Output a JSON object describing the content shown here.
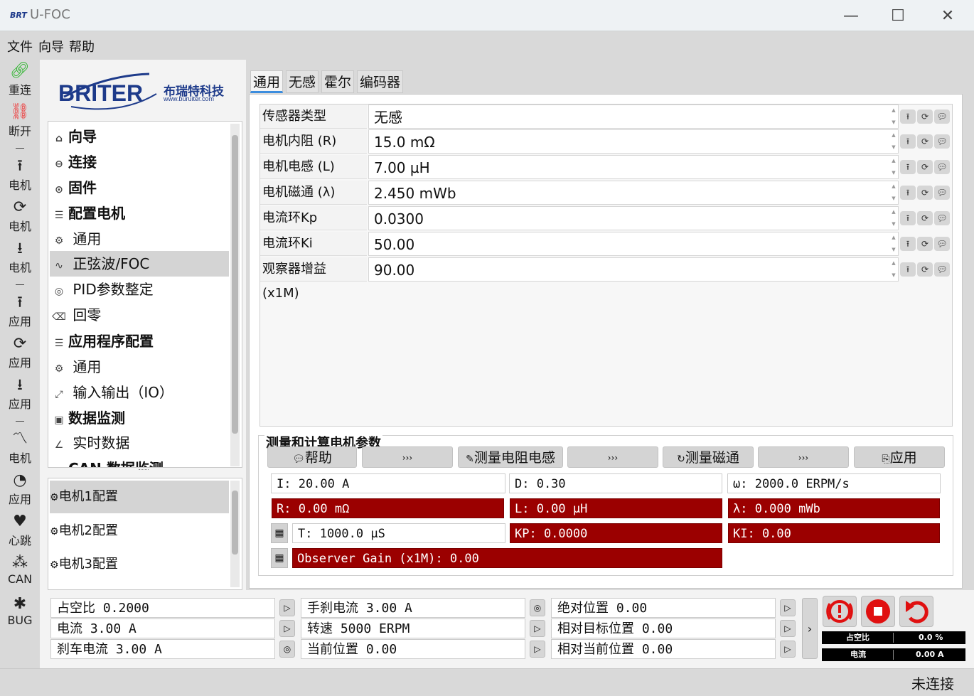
{
  "window": {
    "logo": "BRT",
    "title": "U-FOC",
    "min": "—",
    "max": "☐",
    "close": "✕"
  },
  "menu": [
    "文件",
    "向导",
    "帮助"
  ],
  "leftbar": [
    {
      "label": "重连",
      "icon": "link-icon"
    },
    {
      "label": "断开",
      "icon": "unlink-icon"
    },
    {
      "label": "电机",
      "icon": "upload-icon"
    },
    {
      "label": "电机",
      "icon": "refresh-icon"
    },
    {
      "label": "电机",
      "icon": "download-icon"
    },
    {
      "label": "应用",
      "icon": "upload-icon"
    },
    {
      "label": "应用",
      "icon": "refresh-icon"
    },
    {
      "label": "应用",
      "icon": "download-icon"
    },
    {
      "label": "电机",
      "icon": "chart-icon"
    },
    {
      "label": "应用",
      "icon": "gauge-icon"
    },
    {
      "label": "心跳",
      "icon": "heartbeat-icon"
    },
    {
      "label": "CAN",
      "icon": "can-icon"
    },
    {
      "label": "BUG",
      "icon": "bug-icon"
    }
  ],
  "brand": {
    "name": "BRITER",
    "chinese": "布瑞特科技",
    "url": "www.buruiter.com"
  },
  "nav": [
    {
      "label": "向导",
      "icon": "⌂",
      "bold": true
    },
    {
      "label": "连接",
      "icon": "⊖",
      "bold": true
    },
    {
      "label": "固件",
      "icon": "⊙",
      "bold": true
    },
    {
      "label": "配置电机",
      "icon": "☰",
      "bold": true
    },
    {
      "label": "通用",
      "icon": "⚙",
      "bold": false
    },
    {
      "label": "正弦波/FOC",
      "icon": "∿",
      "bold": false
    },
    {
      "label": "PID参数整定",
      "icon": "◎",
      "bold": false
    },
    {
      "label": "回零",
      "icon": "⌫",
      "bold": false
    },
    {
      "label": "应用程序配置",
      "icon": "☰",
      "bold": true
    },
    {
      "label": "通用",
      "icon": "⚙",
      "bold": false
    },
    {
      "label": "输入输出（IO）",
      "icon": "⤢",
      "bold": false
    },
    {
      "label": "数据监测",
      "icon": "▣",
      "bold": true
    },
    {
      "label": "实时数据",
      "icon": "∠",
      "bold": false
    },
    {
      "label": "CAN 数据监测",
      "icon": "",
      "bold": true
    }
  ],
  "motors": [
    "电机1配置",
    "电机2配置",
    "电机3配置"
  ],
  "tabs": [
    "通用",
    "无感",
    "霍尔",
    "编码器"
  ],
  "params": [
    {
      "label": "传感器类型",
      "value": "无感"
    },
    {
      "label": "电机内阻 (R)",
      "value": "15.0 mΩ"
    },
    {
      "label": "电机电感 (L)",
      "value": "7.00 µH"
    },
    {
      "label": "电机磁通 (λ)",
      "value": "2.450 mWb"
    },
    {
      "label": "电流环Kp",
      "value": "0.0300"
    },
    {
      "label": "电流环Ki",
      "value": "50.00"
    },
    {
      "label": "观察器增益 (x1M)",
      "value": "90.00"
    }
  ],
  "measure": {
    "title": "测量和计算电机参数",
    "help": "帮助",
    "arrow": "›››",
    "measure_rl": "测量电阻电感",
    "measure_flux": "测量磁通",
    "apply": "应用",
    "i": "I: 20.00 A",
    "d": "D: 0.30",
    "omega": "ω: 2000.0 ERPM/s",
    "r": "R: 0.00 mΩ",
    "l": "L: 0.00 µH",
    "lambda": "λ: 0.000 mWb",
    "t": "T: 1000.0 µS",
    "kp": "KP: 0.0000",
    "ki": "KI: 0.00",
    "observer": "Observer Gain (x1M): 0.00"
  },
  "bottom": {
    "duty": "占空比 0.2000",
    "current": "电流 3.00 A",
    "brake": "刹车电流 3.00 A",
    "handbrake": "手刹电流 3.00 A",
    "speed": "转速 5000 ERPM",
    "curpos": "当前位置 0.00",
    "abspos": "绝对位置 0.00",
    "reltarget": "相对目标位置 0.00",
    "relcur": "相对当前位置 0.00",
    "mini_duty_label": "占空比",
    "mini_duty_value": "0.0 %",
    "mini_current_label": "电流",
    "mini_current_value": "0.00 A"
  },
  "status": "未连接",
  "colors": {
    "accent": "#3c8dde",
    "danger": "#9b0000",
    "stop": "#e01010"
  }
}
